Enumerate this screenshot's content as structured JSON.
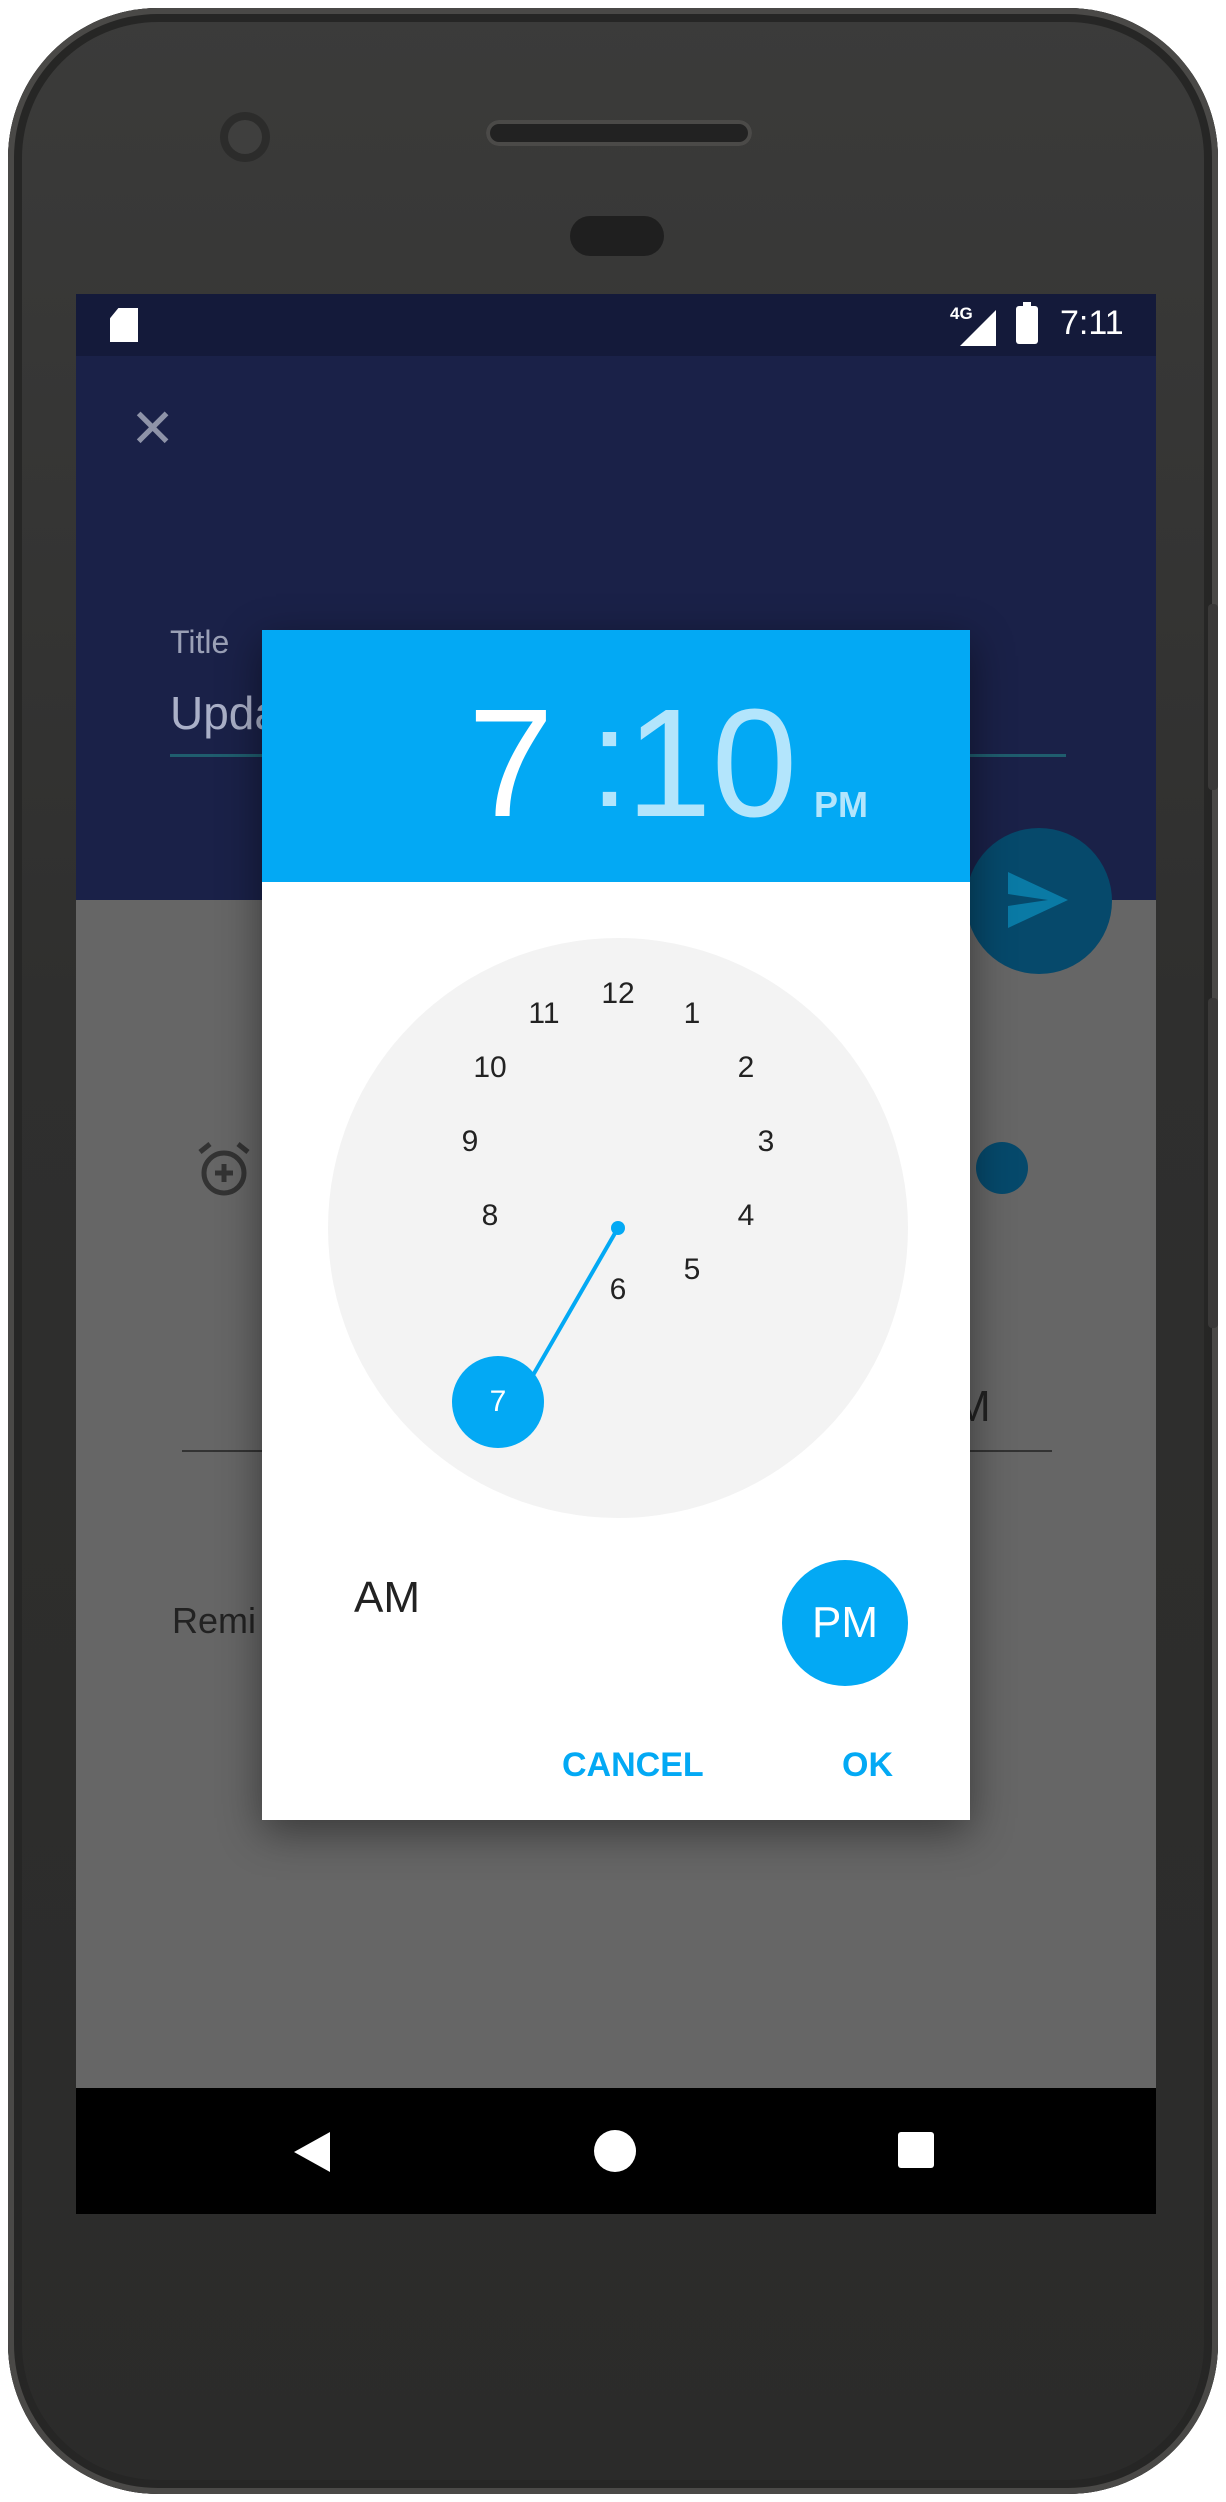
{
  "status_bar": {
    "network": "4G",
    "time": "7:11"
  },
  "app": {
    "title_label": "Title",
    "title_value": "Upda",
    "behind_value_suffix": "M",
    "reminder_text": "Remi"
  },
  "dialog": {
    "hour": "7",
    "separator": ":",
    "minute": "10",
    "period": "PM",
    "clock_numbers": [
      "12",
      "1",
      "2",
      "3",
      "4",
      "5",
      "6",
      "7",
      "8",
      "9",
      "10",
      "11"
    ],
    "selected_number": "7",
    "am_label": "AM",
    "pm_label": "PM",
    "cancel_label": "CANCEL",
    "ok_label": "OK"
  },
  "colors": {
    "accent": "#03a9f4",
    "app_bar": "#1a2148",
    "fab": "#06496b",
    "scrim": "#666666"
  },
  "icons": [
    "sd-card-icon",
    "signal-icon",
    "battery-icon",
    "close-icon",
    "send-icon",
    "alarm-add-icon",
    "back-icon",
    "home-icon",
    "recents-icon"
  ]
}
